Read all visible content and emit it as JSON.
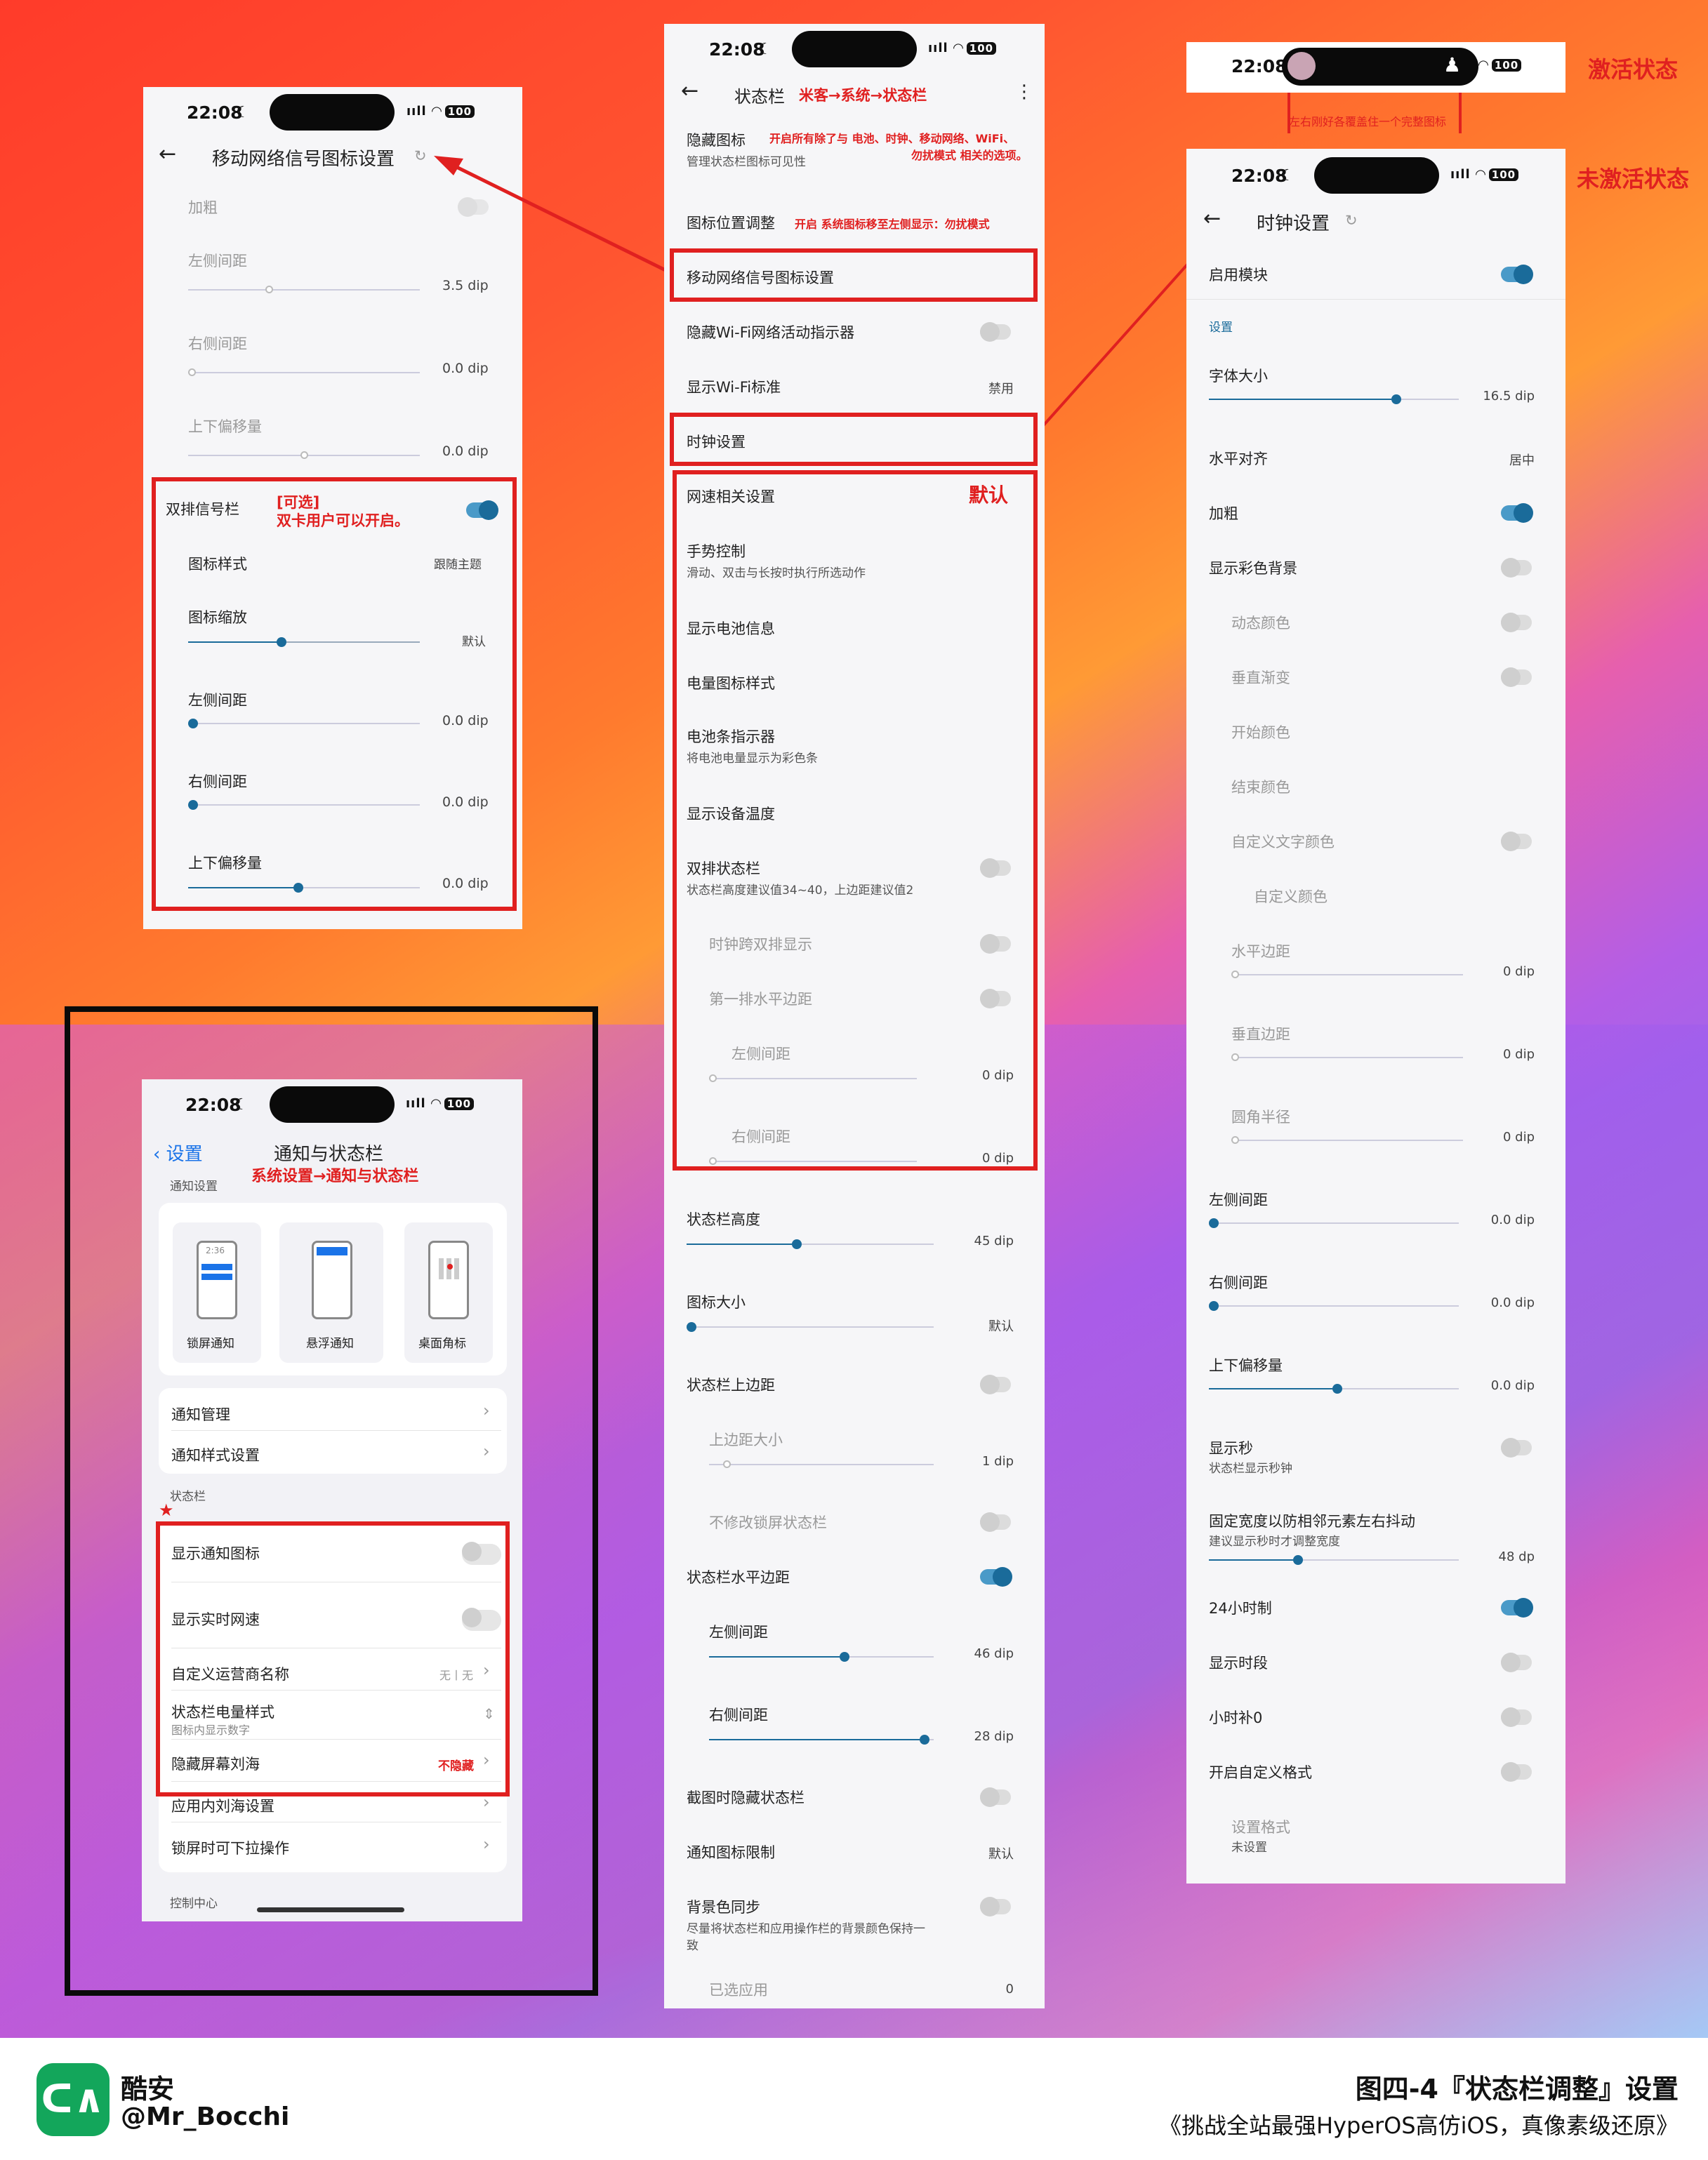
{
  "colors": {
    "accent": "#1a6b9a",
    "annotation": "#e02020",
    "ios_blue": "#1a73e8"
  },
  "status_bar": {
    "time": "22:08",
    "battery": "100"
  },
  "labels": {
    "active_state": "激活状态",
    "inactive_state": "未激活状态",
    "island_note": "左右刚好各覆盖住一个完整图标"
  },
  "mobile_signal": {
    "title": "移动网络信号图标设置",
    "rows": [
      {
        "label": "加粗"
      },
      {
        "label": "左侧间距",
        "value": "3.5 dip"
      },
      {
        "label": "右侧间距",
        "value": "0.0 dip"
      },
      {
        "label": "上下偏移量",
        "value": "0.0 dip"
      },
      {
        "label": "双排信号栏"
      },
      {
        "label": "图标样式",
        "value": "跟随主题"
      },
      {
        "label": "图标缩放",
        "value": "默认"
      },
      {
        "label": "左侧间距",
        "value": "0.0 dip"
      },
      {
        "label": "右侧间距",
        "value": "0.0 dip"
      },
      {
        "label": "上下偏移量",
        "value": "0.0 dip"
      }
    ],
    "note_optional": "[可选]",
    "note_dual": "双卡用户可以开启。"
  },
  "statusbar_page": {
    "title": "状态栏",
    "path_note": "米客→系统→状态栏",
    "rows": [
      {
        "label": "隐藏图标",
        "sub": "管理状态栏图标可见性",
        "note1": "开启所有除了与 电池、时钟、移动网络、WiFi、",
        "note2": "勿扰模式 相关的选项。"
      },
      {
        "label": "图标位置调整",
        "note": "开启 系统图标移至左侧显示：勿扰模式"
      },
      {
        "label": "移动网络信号图标设置"
      },
      {
        "label": "隐藏Wi-Fi网络活动指示器"
      },
      {
        "label": "显示Wi-Fi标准",
        "value": "禁用"
      },
      {
        "label": "时钟设置"
      },
      {
        "label": "网速相关设置",
        "note": "默认"
      },
      {
        "label": "手势控制",
        "sub": "滑动、双击与长按时执行所选动作"
      },
      {
        "label": "显示电池信息"
      },
      {
        "label": "电量图标样式"
      },
      {
        "label": "电池条指示器",
        "sub": "将电池电量显示为彩色条"
      },
      {
        "label": "显示设备温度"
      },
      {
        "label": "双排状态栏",
        "sub": "状态栏高度建议值34~40，上边距建议值2"
      },
      {
        "label": "时钟跨双排显示"
      },
      {
        "label": "第一排水平边距"
      },
      {
        "label": "左侧间距",
        "value": "0 dip"
      },
      {
        "label": "右侧间距",
        "value": "0 dip"
      },
      {
        "label": "状态栏高度",
        "value": "45 dip"
      },
      {
        "label": "图标大小",
        "value": "默认"
      },
      {
        "label": "状态栏上边距"
      },
      {
        "label": "上边距大小",
        "value": "1 dip"
      },
      {
        "label": "不修改锁屏状态栏"
      },
      {
        "label": "状态栏水平边距"
      },
      {
        "label": "左侧间距",
        "value": "46 dip"
      },
      {
        "label": "右侧间距",
        "value": "28 dip"
      },
      {
        "label": "截图时隐藏状态栏"
      },
      {
        "label": "通知图标限制",
        "value": "默认"
      },
      {
        "label": "背景色同步",
        "sub1": "尽量将状态栏和应用操作栏的背景颜色保持一",
        "sub2": "致"
      },
      {
        "label": "已选应用",
        "value": "0"
      }
    ]
  },
  "clock_page": {
    "title": "时钟设置",
    "rows": [
      {
        "label": "启用模块"
      },
      {
        "label": "设置"
      },
      {
        "label": "字体大小",
        "value": "16.5 dip"
      },
      {
        "label": "水平对齐",
        "value": "居中"
      },
      {
        "label": "加粗"
      },
      {
        "label": "显示彩色背景"
      },
      {
        "label": "动态颜色"
      },
      {
        "label": "垂直渐变"
      },
      {
        "label": "开始颜色"
      },
      {
        "label": "结束颜色"
      },
      {
        "label": "自定义文字颜色"
      },
      {
        "label": "自定义颜色"
      },
      {
        "label": "水平边距",
        "value": "0 dip"
      },
      {
        "label": "垂直边距",
        "value": "0 dip"
      },
      {
        "label": "圆角半径",
        "value": "0 dip"
      },
      {
        "label": "左侧间距",
        "value": "0.0 dip"
      },
      {
        "label": "右侧间距",
        "value": "0.0 dip"
      },
      {
        "label": "上下偏移量",
        "value": "0.0 dip"
      },
      {
        "label": "显示秒",
        "sub": "状态栏显示秒钟"
      },
      {
        "label": "固定宽度以防相邻元素左右抖动",
        "sub": "建议显示秒时才调整宽度",
        "value": "48 dp"
      },
      {
        "label": "24小时制"
      },
      {
        "label": "显示时段"
      },
      {
        "label": "小时补0"
      },
      {
        "label": "开启自定义格式"
      },
      {
        "label": "设置格式",
        "sub": "未设置"
      }
    ]
  },
  "notif_page": {
    "back": "设置",
    "title": "通知与状态栏",
    "path_note": "系统设置→通知与状态栏",
    "section1": "通知设置",
    "cards": [
      "锁屏通知",
      "悬浮通知",
      "桌面角标"
    ],
    "mini_time": "2:36",
    "rows1": [
      "通知管理",
      "通知样式设置"
    ],
    "section2": "状态栏",
    "star": "★",
    "rows2": [
      {
        "label": "显示通知图标"
      },
      {
        "label": "显示实时网速"
      },
      {
        "label": "自定义运营商名称",
        "value": "无丨无"
      },
      {
        "label": "状态栏电量样式",
        "sub": "图标内显示数字"
      },
      {
        "label": "隐藏屏幕刘海",
        "value": "不隐藏"
      },
      {
        "label": "应用内刘海设置"
      },
      {
        "label": "锁屏时可下拉操作"
      }
    ],
    "section3": "控制中心"
  },
  "footer": {
    "brand": "酷安",
    "user": "@Mr_Bocchi",
    "figure": "图四-4『状态栏调整』设置",
    "subtitle": "《挑战全站最强HyperOS高仿iOS，真像素级还原》"
  }
}
